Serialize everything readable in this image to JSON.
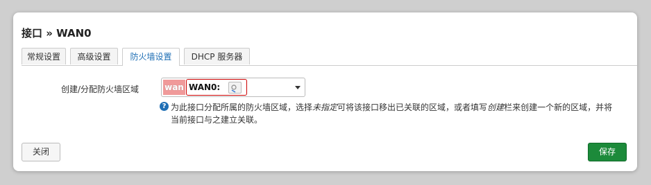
{
  "modal": {
    "title": "接口 » WAN0"
  },
  "tabs": [
    {
      "label": "常规设置",
      "active": false
    },
    {
      "label": "高级设置",
      "active": false
    },
    {
      "label": "防火墙设置",
      "active": true
    },
    {
      "label": "DHCP 服务器",
      "active": false
    }
  ],
  "firewall": {
    "field_label": "创建/分配防火墙区域",
    "zone_name": "wan",
    "zone_network": "WAN0:",
    "zone_color": "#f09a9a",
    "help_icon": "question-icon",
    "help_part1": "为此接口分配所属的防火墙区域，选择",
    "help_em1": "未指定",
    "help_part2": "可将该接口移出已关联的区域，或者填写",
    "help_em2": "创建",
    "help_part3": "栏来创建一个新的区域，并将当前接口与之建立关联。"
  },
  "footer": {
    "close_label": "关闭",
    "save_label": "保存",
    "save_color": "#1c8a3a"
  }
}
